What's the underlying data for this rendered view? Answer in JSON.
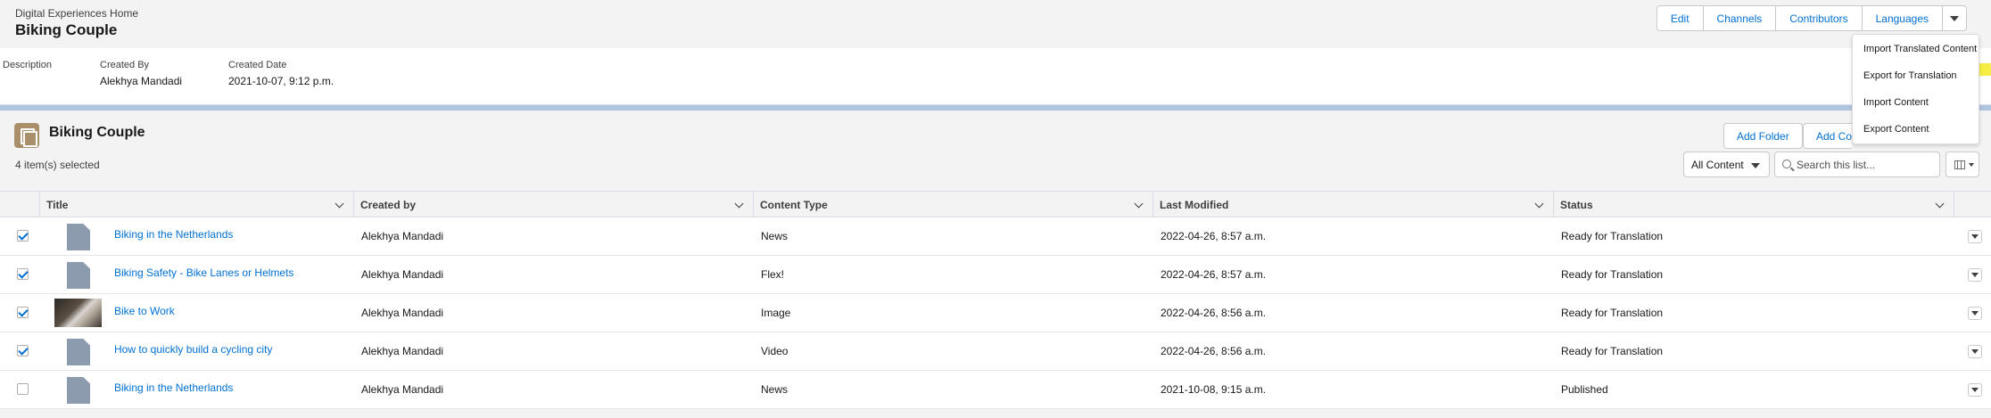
{
  "header": {
    "breadcrumb": "Digital Experiences Home",
    "title": "Biking Couple",
    "actions": [
      "Edit",
      "Channels",
      "Contributors",
      "Languages"
    ]
  },
  "details": {
    "description_label": "Description",
    "created_by_label": "Created By",
    "created_by_value": "Alekhya Mandadi",
    "created_date_label": "Created Date",
    "created_date_value": "2021-10-07, 9:12 p.m."
  },
  "dropdown": {
    "items": [
      "Import Translated Content",
      "Export for Translation",
      "Import Content",
      "Export Content"
    ],
    "highlighted": "Export for Translation",
    "highlight_color": "#f4ec37"
  },
  "list": {
    "title": "Biking Couple",
    "selected_text": "4 item(s) selected",
    "add_folder_label": "Add Folder",
    "add_content_label": "Add Co",
    "filter_value": "All Content",
    "search_placeholder": "Search this list...",
    "columns": [
      "Title",
      "Created by",
      "Content Type",
      "Last Modified",
      "Status"
    ],
    "rows": [
      {
        "checked": true,
        "icon": "document-icon",
        "title": "Biking in the Netherlands",
        "created_by": "Alekhya Mandadi",
        "type": "News",
        "modified": "2022-04-26, 8:57 a.m.",
        "status": "Ready for Translation"
      },
      {
        "checked": true,
        "icon": "document-icon",
        "title": "Biking Safety - Bike Lanes or Helmets",
        "created_by": "Alekhya Mandadi",
        "type": "Flex!",
        "modified": "2022-04-26, 8:57 a.m.",
        "status": "Ready for Translation"
      },
      {
        "checked": true,
        "icon": "image-thumbnail",
        "title": "Bike to Work",
        "created_by": "Alekhya Mandadi",
        "type": "Image",
        "modified": "2022-04-26, 8:56 a.m.",
        "status": "Ready for Translation"
      },
      {
        "checked": true,
        "icon": "document-icon",
        "title": "How to quickly build a cycling city",
        "created_by": "Alekhya Mandadi",
        "type": "Video",
        "modified": "2022-04-26, 8:56 a.m.",
        "status": "Ready for Translation"
      },
      {
        "checked": false,
        "icon": "document-icon",
        "title": "Biking in the Netherlands",
        "created_by": "Alekhya Mandadi",
        "type": "News",
        "modified": "2021-10-08, 9:15 a.m.",
        "status": "Published"
      }
    ]
  },
  "colors": {
    "link": "#0070d2",
    "stripe": "#b0c4df",
    "folder_icon": "#a9906a"
  }
}
